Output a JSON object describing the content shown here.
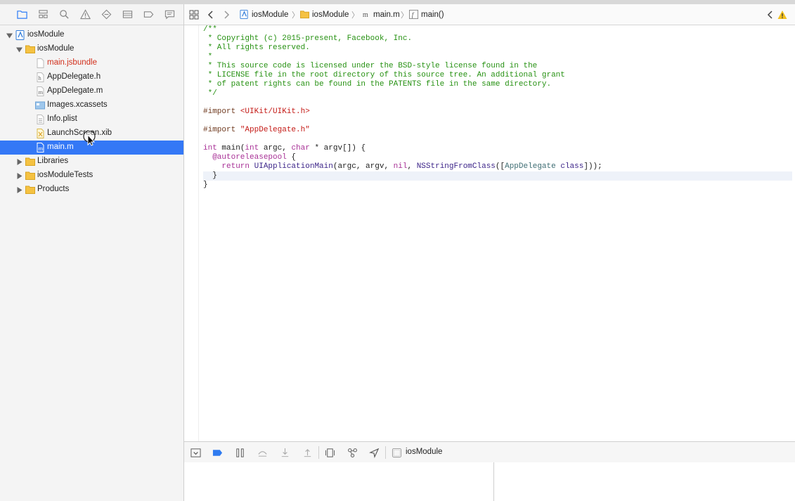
{
  "navigator": {
    "tabs": [
      {
        "name": "folder-icon",
        "active": true
      },
      {
        "name": "hierarchy-icon"
      },
      {
        "name": "search-icon"
      },
      {
        "name": "warning-icon"
      },
      {
        "name": "diamond-icon"
      },
      {
        "name": "list-icon"
      },
      {
        "name": "tag-icon"
      },
      {
        "name": "comment-icon"
      }
    ],
    "rows": [
      {
        "label": "iosModule",
        "icon": "project-icon",
        "expanded": true,
        "level": 0
      },
      {
        "label": "iosModule",
        "icon": "folder-icon",
        "expanded": true,
        "level": 1
      },
      {
        "label": "main.jsbundle",
        "icon": "blank-file-icon",
        "level": 2,
        "red": true
      },
      {
        "label": "AppDelegate.h",
        "icon": "header-file-icon",
        "level": 2,
        "glyph": "h"
      },
      {
        "label": "AppDelegate.m",
        "icon": "impl-file-icon",
        "level": 2,
        "glyph": "m"
      },
      {
        "label": "Images.xcassets",
        "icon": "asset-catalog-icon",
        "level": 2
      },
      {
        "label": "Info.plist",
        "icon": "plist-file-icon",
        "level": 2
      },
      {
        "label": "LaunchScreen.xib",
        "icon": "xib-file-icon",
        "level": 2
      },
      {
        "label": "main.m",
        "icon": "impl-file-icon",
        "level": 2,
        "glyph": "m",
        "selected": true
      },
      {
        "label": "Libraries",
        "icon": "folder-icon",
        "expanded": false,
        "level": 1
      },
      {
        "label": "iosModuleTests",
        "icon": "folder-icon",
        "expanded": false,
        "level": 1
      },
      {
        "label": "Products",
        "icon": "folder-icon",
        "expanded": false,
        "level": 1
      }
    ]
  },
  "jumpbar": {
    "crumbs": [
      {
        "label": "iosModule",
        "icon": "project-icon"
      },
      {
        "label": "iosModule",
        "icon": "folder-icon"
      },
      {
        "label": "main.m",
        "icon": "impl-file-icon"
      },
      {
        "label": "main()",
        "icon": "function-icon"
      }
    ]
  },
  "code": {
    "lines": [
      [
        [
          "c-com",
          "/**"
        ]
      ],
      [
        [
          "c-com",
          " * Copyright (c) 2015-present, Facebook, Inc."
        ]
      ],
      [
        [
          "c-com",
          " * All rights reserved."
        ]
      ],
      [
        [
          "c-com",
          " *"
        ]
      ],
      [
        [
          "c-com",
          " * This source code is licensed under the BSD-style license found in the"
        ]
      ],
      [
        [
          "c-com",
          " * LICENSE file in the root directory of this source tree. An additional grant"
        ]
      ],
      [
        [
          "c-com",
          " * of patent rights can be found in the PATENTS file in the same directory."
        ]
      ],
      [
        [
          "c-com",
          " */"
        ]
      ],
      [],
      [
        [
          "c-pp",
          "#import "
        ],
        [
          "c-str",
          "<UIKit/UIKit.h>"
        ]
      ],
      [],
      [
        [
          "c-pp",
          "#import "
        ],
        [
          "c-str",
          "\"AppDelegate.h\""
        ]
      ],
      [],
      [
        [
          "c-kw",
          "int"
        ],
        [
          "c-plain",
          " main("
        ],
        [
          "c-kw",
          "int"
        ],
        [
          "c-plain",
          " argc, "
        ],
        [
          "c-kw",
          "char"
        ],
        [
          "c-plain",
          " * argv[]) {"
        ]
      ],
      [
        [
          "c-plain",
          "  "
        ],
        [
          "c-kw",
          "@autoreleasepool"
        ],
        [
          "c-plain",
          " {"
        ]
      ],
      [
        [
          "c-plain",
          "    "
        ],
        [
          "c-kw",
          "return"
        ],
        [
          "c-plain",
          " "
        ],
        [
          "c-fn",
          "UIApplicationMain"
        ],
        [
          "c-plain",
          "(argc, argv, "
        ],
        [
          "c-kw",
          "nil"
        ],
        [
          "c-plain",
          ", "
        ],
        [
          "c-fn",
          "NSStringFromClass"
        ],
        [
          "c-plain",
          "(["
        ],
        [
          "c-cls",
          "AppDelegate"
        ],
        [
          "c-plain",
          " "
        ],
        [
          "c-fn",
          "class"
        ],
        [
          "c-plain",
          "]));"
        ]
      ],
      [
        [
          "c-plain",
          "  }"
        ]
      ],
      [
        [
          "c-plain",
          "}"
        ]
      ]
    ],
    "highlighted_line": 17
  },
  "debugbar": {
    "scheme_label": "iosModule"
  }
}
